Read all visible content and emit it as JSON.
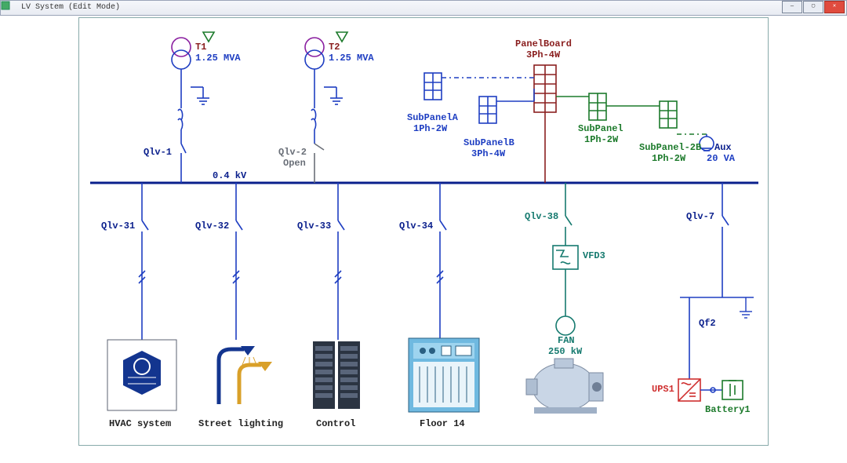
{
  "window": {
    "title": "LV System (Edit Mode)"
  },
  "bus": {
    "voltage": "0.4 kV"
  },
  "transformers": {
    "t1": {
      "name": "T1",
      "rating": "1.25 MVA"
    },
    "t2": {
      "name": "T2",
      "rating": "1.25 MVA"
    }
  },
  "breakers": {
    "qlv1": {
      "name": "Qlv-1"
    },
    "qlv2": {
      "name": "Qlv-2",
      "state": "Open"
    },
    "qlv31": {
      "name": "Qlv-31"
    },
    "qlv32": {
      "name": "Qlv-32"
    },
    "qlv33": {
      "name": "Qlv-33"
    },
    "qlv34": {
      "name": "Qlv-34"
    },
    "qlv38": {
      "name": "Qlv-38"
    },
    "qlv7": {
      "name": "Qlv-7"
    },
    "qf2": {
      "name": "Qf2"
    }
  },
  "panels": {
    "main": {
      "name": "PanelBoard",
      "spec": "3Ph-4W"
    },
    "subA": {
      "name": "SubPanelA",
      "spec": "1Ph-2W"
    },
    "subB": {
      "name": "SubPanelB",
      "spec": "3Ph-4W"
    },
    "sub1": {
      "name": "SubPanel",
      "spec": "1Ph-2W"
    },
    "sub2b": {
      "name": "SubPanel-2B",
      "spec": "1Ph-2W"
    },
    "aux": {
      "name": "Aux",
      "rating": "20 VA"
    }
  },
  "drives": {
    "vfd3": {
      "name": "VFD3"
    }
  },
  "loads": {
    "fan": {
      "name": "FAN",
      "rating": "250 kW"
    },
    "hvac": {
      "name": "HVAC system"
    },
    "street": {
      "name": "Street lighting"
    },
    "control": {
      "name": "Control"
    },
    "floor14": {
      "name": "Floor 14"
    },
    "ups1": {
      "name": "UPS1"
    },
    "battery1": {
      "name": "Battery1"
    }
  }
}
